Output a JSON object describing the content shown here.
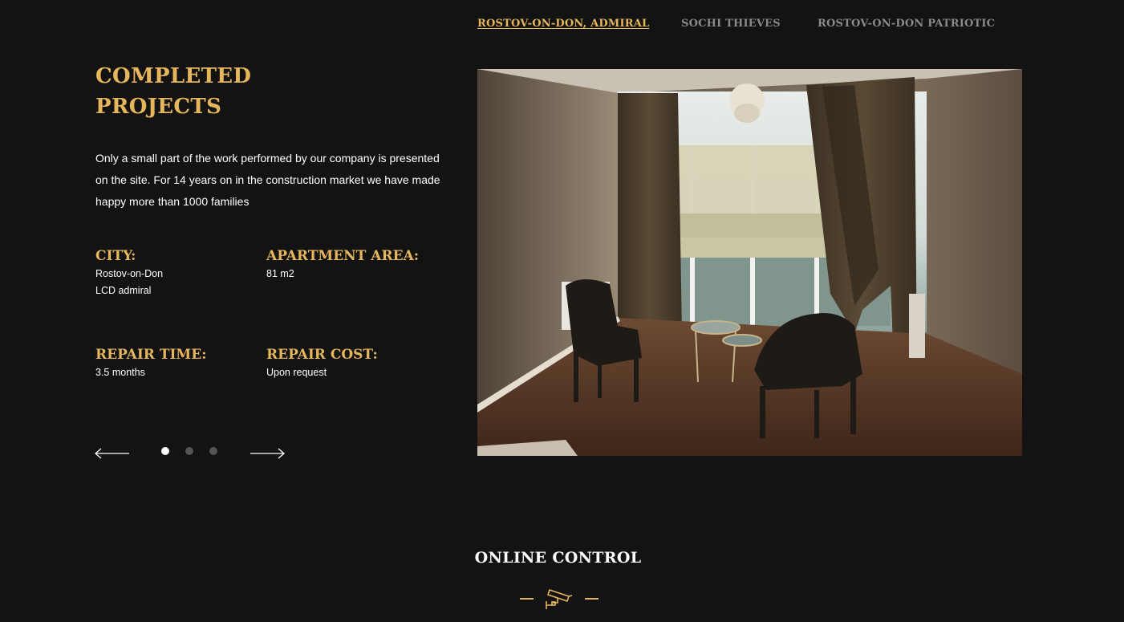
{
  "tabs": [
    {
      "label": "ROSTOV-ON-DON, ADMIRAL",
      "active": true
    },
    {
      "label": "SOCHI THIEVES",
      "active": false
    },
    {
      "label": "ROSTOV-ON-DON PATRIOTIC",
      "active": false
    }
  ],
  "section": {
    "title_line1": "COMPLETED",
    "title_line2": "PROJECTS",
    "description": "Only a small part of the work performed by our company is presented on the site. For 14 years on in the construction market we have made happy more than 1000 families"
  },
  "details": {
    "city_label": "CITY:",
    "city_line1": "Rostov-on-Don",
    "city_line2": "LCD admiral",
    "area_label": "APARTMENT AREA:",
    "area_value": "81 m2",
    "time_label": "REPAIR TIME:",
    "time_value": "3.5 months",
    "cost_label": "REPAIR COST:",
    "cost_value": "Upon request"
  },
  "slider": {
    "current_slide": 1,
    "total_slides": 3
  },
  "online_control": {
    "title": "ONLINE CONTROL",
    "icon": "cctv-camera-icon"
  },
  "colors": {
    "background": "#131313",
    "accent": "#e6b65c",
    "inactive_tab": "#8a8a8a"
  }
}
